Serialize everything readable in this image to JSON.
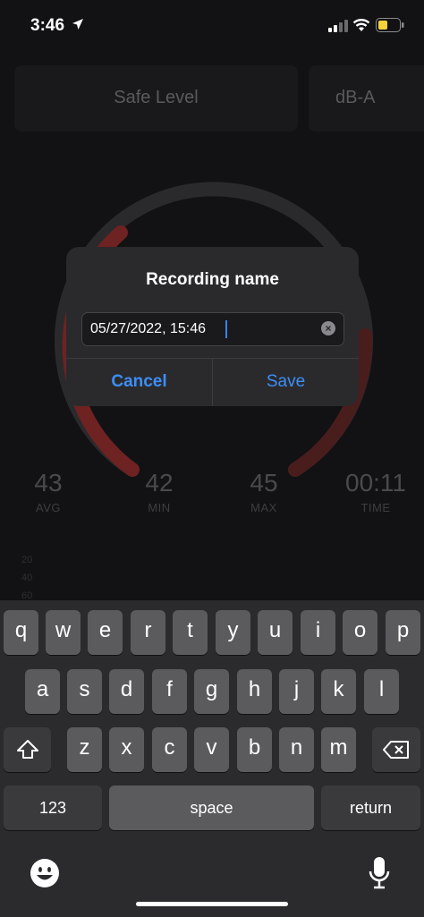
{
  "status_bar": {
    "time": "3:46"
  },
  "tiles": {
    "safe_level": "Safe Level",
    "unit": "dB-A"
  },
  "stats": [
    {
      "value": "43",
      "label": "AVG"
    },
    {
      "value": "42",
      "label": "MIN"
    },
    {
      "value": "45",
      "label": "MAX"
    },
    {
      "value": "00:11",
      "label": "TIME"
    }
  ],
  "chart_ticks": [
    "20",
    "40",
    "60"
  ],
  "dialog": {
    "title": "Recording name",
    "input_value": "05/27/2022, 15:46",
    "cancel_label": "Cancel",
    "save_label": "Save"
  },
  "keyboard": {
    "row1": [
      "q",
      "w",
      "e",
      "r",
      "t",
      "y",
      "u",
      "i",
      "o",
      "p"
    ],
    "row2": [
      "a",
      "s",
      "d",
      "f",
      "g",
      "h",
      "j",
      "k",
      "l"
    ],
    "row3": [
      "z",
      "x",
      "c",
      "v",
      "b",
      "n",
      "m"
    ],
    "numbers_label": "123",
    "space_label": "space",
    "return_label": "return"
  },
  "colors": {
    "accent": "#3d8ef7",
    "gauge_red": "#7a2020"
  }
}
